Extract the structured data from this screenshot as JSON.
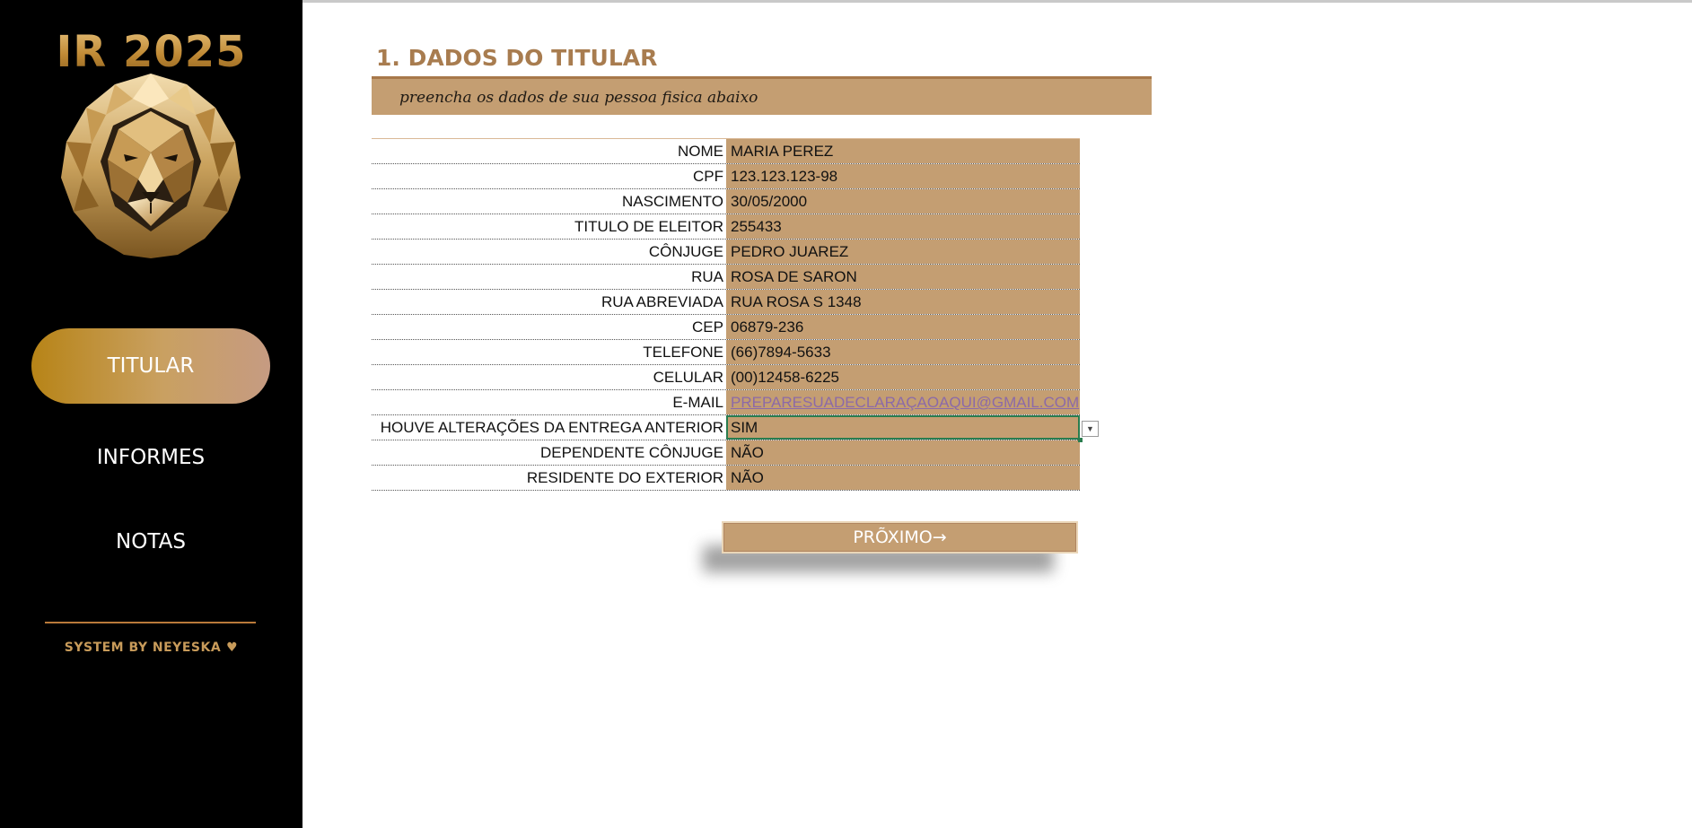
{
  "brand": {
    "title": "IR 2025"
  },
  "sidebar": {
    "items": [
      {
        "label": "TITULAR",
        "active": true
      },
      {
        "label": "INFORMES",
        "active": false
      },
      {
        "label": "NOTAS",
        "active": false
      }
    ],
    "footer": "SYSTEM BY NEYESKA",
    "footer_icon": "heart-icon"
  },
  "section": {
    "title": "1. DADOS DO TITULAR",
    "subtitle": "preencha os dados de sua pessoa fisica abaixo"
  },
  "form": {
    "rows": [
      {
        "label": "NOME",
        "value": "MARIA PEREZ"
      },
      {
        "label": "CPF",
        "value": "123.123.123-98"
      },
      {
        "label": "NASCIMENTO",
        "value": "30/05/2000"
      },
      {
        "label": "TITULO DE ELEITOR",
        "value": "255433"
      },
      {
        "label": "CÔNJUGE",
        "value": "PEDRO JUAREZ"
      },
      {
        "label": "RUA",
        "value": "ROSA DE SARON"
      },
      {
        "label": "RUA ABREVIADA",
        "value": "RUA ROSA S 1348"
      },
      {
        "label": "CEP",
        "value": "06879-236"
      },
      {
        "label": "TELEFONE",
        "value": "(66)7894-5633"
      },
      {
        "label": "CELULAR",
        "value": "(00)12458-6225"
      },
      {
        "label": "E-MAIL",
        "value": "PREPARESUADECLARAÇAOAQUI@GMAIL.COM"
      },
      {
        "label": "HOUVE ALTERAÇÕES DA ENTREGA ANTERIOR",
        "value": "SIM"
      },
      {
        "label": "DEPENDENTE CÔNJUGE",
        "value": "NÃO"
      },
      {
        "label": "RESIDENTE DO EXTERIOR",
        "value": "NÃO"
      }
    ]
  },
  "next_button": {
    "label": "PRÕXIMO→"
  },
  "colors": {
    "sidebar_bg": "#000000",
    "accent_tan": "#c49e72",
    "title_brown": "#a87c4f",
    "gold": "#b78417",
    "selection_green": "#2a7d4f",
    "link_purple": "#8b6aa8"
  }
}
